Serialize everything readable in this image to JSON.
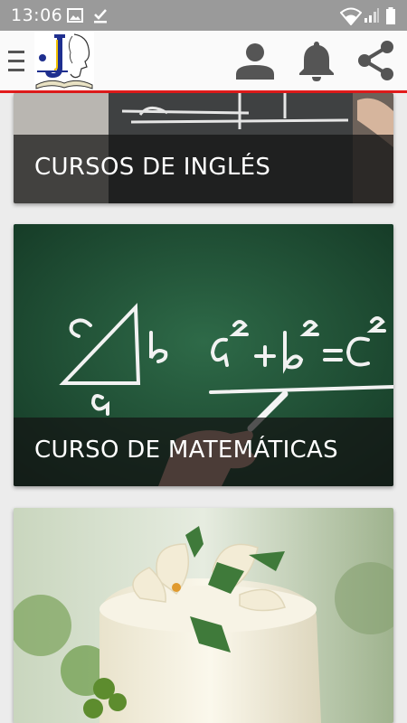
{
  "status_bar": {
    "time": "13:06",
    "left_icons": [
      "image-icon",
      "download-done-icon"
    ],
    "right_icons": [
      "wifi-icon",
      "signal-icon",
      "battery-icon"
    ]
  },
  "app_bar": {
    "menu_icon": "hamburger-icon",
    "logo": "j-logo",
    "actions": [
      "user-icon",
      "bell-icon",
      "share-icon"
    ],
    "accent_color": "#e21b1b"
  },
  "cards": [
    {
      "title": "CURSOS DE INGLÉS",
      "image": "chalkboard-writing"
    },
    {
      "title": "CURSO DE MATEMÁTICAS",
      "image": "pythagoras-chalkboard"
    },
    {
      "title": "",
      "image": "decorated-cake"
    }
  ]
}
